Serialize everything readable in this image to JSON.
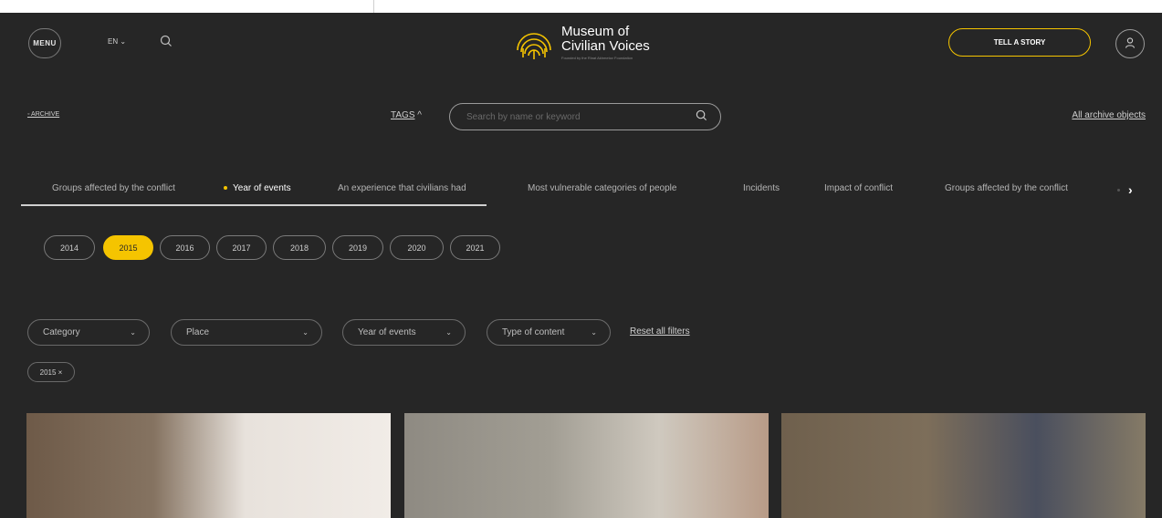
{
  "header": {
    "menu_label": "MENU",
    "language": "EN ⌄",
    "logo_title_line1": "Museum of",
    "logo_title_line2": "Civilian Voices",
    "logo_subtitle": "Founded by the Rinat Akhmetov Foundation",
    "tell_story_label": "TELL A STORY"
  },
  "search": {
    "breadcrumb": "◦ ARCHIVE",
    "tags_label": "TAGS",
    "tags_caret": "^",
    "placeholder": "Search by name or keyword",
    "all_objects_link": "All archive objects"
  },
  "tabs": [
    {
      "label": "Groups affected by the conflict",
      "active": false
    },
    {
      "label": "Year of events",
      "active": true
    },
    {
      "label": "An experience that civilians had",
      "active": false
    },
    {
      "label": "Most vulnerable categories of people",
      "active": false
    },
    {
      "label": "Incidents",
      "active": false
    },
    {
      "label": "Impact of conflict",
      "active": false
    },
    {
      "label": "Groups affected by the conflict",
      "active": false
    }
  ],
  "years": [
    {
      "label": "2014",
      "active": false
    },
    {
      "label": "2015",
      "active": true
    },
    {
      "label": "2016",
      "active": false
    },
    {
      "label": "2017",
      "active": false
    },
    {
      "label": "2018",
      "active": false
    },
    {
      "label": "2019",
      "active": false
    },
    {
      "label": "2020",
      "active": false
    },
    {
      "label": "2021",
      "active": false
    }
  ],
  "filters": [
    {
      "label": "Category"
    },
    {
      "label": "Place"
    },
    {
      "label": "Year of events"
    },
    {
      "label": "Type of content"
    }
  ],
  "reset_label": "Reset all filters",
  "active_chip": "2015 ×",
  "colors": {
    "background": "#262626",
    "accent": "#f5c400",
    "text": "#bfbfbf"
  }
}
